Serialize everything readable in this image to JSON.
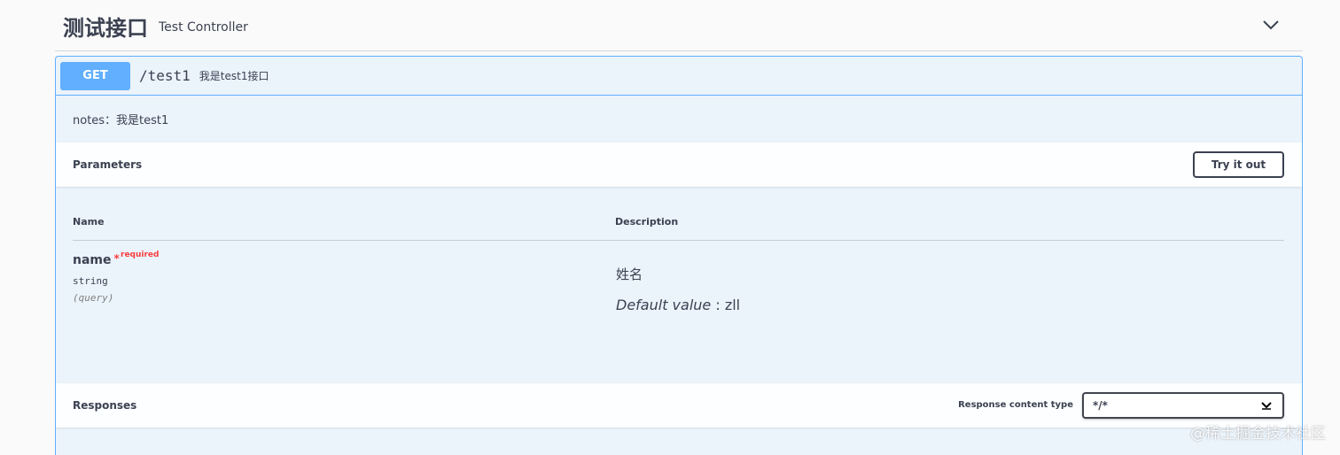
{
  "tag": {
    "title": "测试接口",
    "description": "Test Controller",
    "toggle_icon": "chevron-down-icon"
  },
  "operation": {
    "method": "GET",
    "path": "/test1",
    "summary": "我是test1接口",
    "notes": "notes：我是test1",
    "method_color": "#61affe"
  },
  "parameters": {
    "section_title": "Parameters",
    "try_button": "Try it out",
    "col_name": "Name",
    "col_description": "Description",
    "items": [
      {
        "name": "name",
        "required_star": "*",
        "required_label": "required",
        "type": "string",
        "in": "(query)",
        "description": "姓名",
        "default_label": "Default value",
        "default_sep": " : ",
        "default_value": "zll"
      }
    ]
  },
  "responses": {
    "section_title": "Responses",
    "content_type_label": "Response content type",
    "content_type_value": "*/*"
  },
  "watermark": "@稀土掘金技术社区"
}
